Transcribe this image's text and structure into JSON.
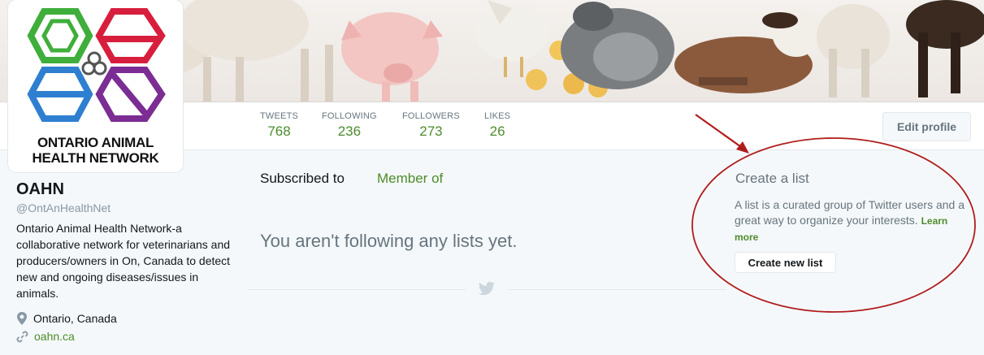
{
  "profile": {
    "name": "OAHN",
    "handle": "@OntAnHealthNet",
    "bio": "Ontario Animal Health Network-a collaborative network for veterinarians and producers/owners in On, Canada to detect new and ongoing diseases/issues in animals.",
    "location": "Ontario, Canada",
    "website": "oahn.ca",
    "avatar_line1": "ONTARIO ANIMAL",
    "avatar_line2": "HEALTH NETWORK"
  },
  "stats": [
    {
      "label": "TWEETS",
      "value": "768"
    },
    {
      "label": "FOLLOWING",
      "value": "236"
    },
    {
      "label": "FOLLOWERS",
      "value": "273"
    },
    {
      "label": "LIKES",
      "value": "26"
    }
  ],
  "edit_profile_label": "Edit profile",
  "tabs": {
    "subscribed": "Subscribed to",
    "member": "Member of"
  },
  "empty_message": "You aren't following any lists yet.",
  "create_list": {
    "title": "Create a list",
    "description": "A list is a curated group of Twitter users and a great way to organize your interests.",
    "learn_more": "Learn more",
    "button": "Create new list"
  },
  "colors": {
    "accent": "#4c8c2b",
    "annotation": "#b01c1c",
    "hex_green": "#3fae3b",
    "hex_red": "#d81e3d",
    "hex_blue": "#2f7fd1",
    "hex_purple": "#7b2d93"
  },
  "icons": {
    "location": "map-pin-icon",
    "link": "link-icon",
    "divider": "twitter-bird-icon"
  }
}
